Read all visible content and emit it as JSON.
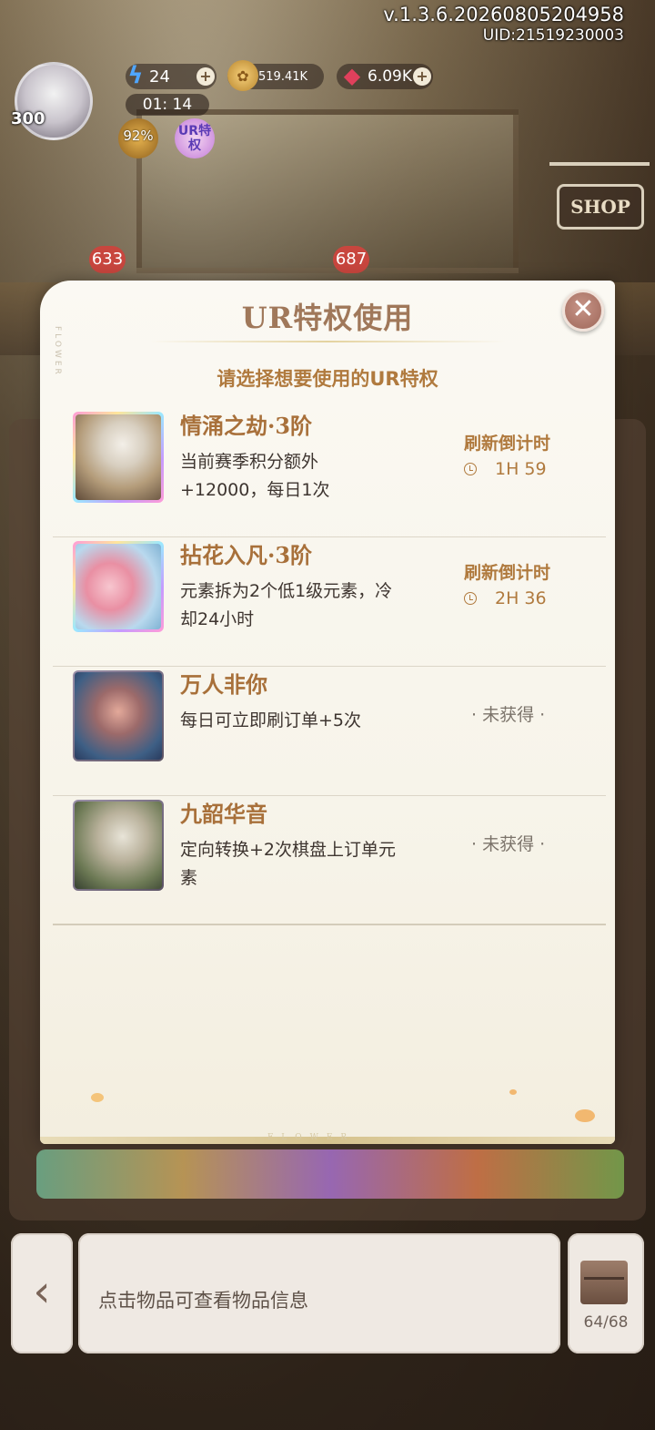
{
  "hud": {
    "version": "v.1.3.6.20260805204958",
    "uid": "UID:21519230003",
    "level": "300",
    "energy": "24",
    "gold": "519.41K",
    "gems": "6.09K",
    "timer": "01: 14",
    "speed_percent": "92%",
    "ur_badge": "UR特权",
    "shop_sign": "SHOP",
    "bubble_left": "633",
    "bubble_right": "687"
  },
  "modal": {
    "title": "UR特权使用",
    "subtitle": "请选择想要使用的UR特权",
    "side_deco": "FLOWER",
    "footer_deco": "FLOWER",
    "close_icon": "close-x-icon",
    "items": [
      {
        "name": "情涌之劫·3阶",
        "desc": "当前赛季积分额外+12000，每日1次",
        "status": "refresh",
        "refresh_label": "刷新倒计时",
        "refresh_time": "1H 59"
      },
      {
        "name": "拈花入凡·3阶",
        "desc": "元素拆为2个低1级元素，冷却24小时",
        "status": "refresh",
        "refresh_label": "刷新倒计时",
        "refresh_time": "2H 36"
      },
      {
        "name": "万人非你",
        "desc": "每日可立即刷订单+5次",
        "status": "locked",
        "not_obtained": "· 未获得 ·"
      },
      {
        "name": "九韶华音",
        "desc": "定向转换+2次棋盘上订单元素",
        "status": "locked",
        "not_obtained": "· 未获得 ·"
      }
    ]
  },
  "bottom": {
    "back_icon": "chevron-left-icon",
    "info_text": "点击物品可查看物品信息",
    "bag_count": "64/68"
  },
  "colors": {
    "title": "#a0785a",
    "accent": "#b07a3e",
    "close_button": "#9e6759"
  }
}
